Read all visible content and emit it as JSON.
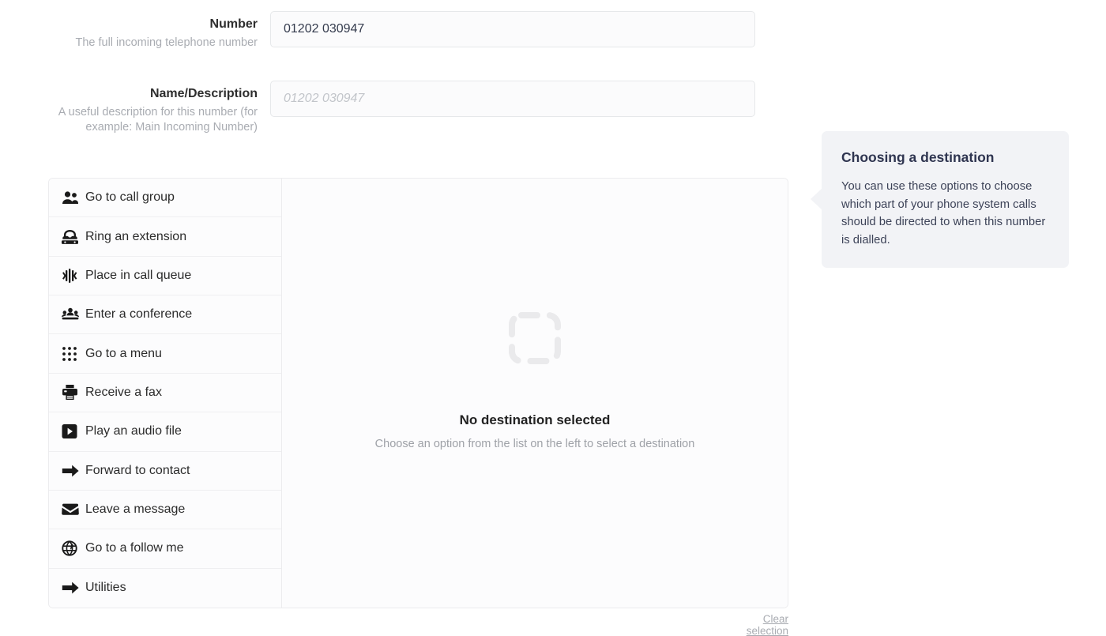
{
  "form": {
    "fields": [
      {
        "title": "Number",
        "help": "The full incoming telephone number",
        "value": "01202 030947",
        "placeholder": ""
      },
      {
        "title": "Name/Description",
        "help": "A useful description for this number (for example: Main Incoming Number)",
        "value": "",
        "placeholder": "01202 030947"
      }
    ]
  },
  "destination": {
    "options": [
      {
        "label": "Go to call group",
        "icon": "users-group-icon"
      },
      {
        "label": "Ring an extension",
        "icon": "telephone-icon"
      },
      {
        "label": "Place in call queue",
        "icon": "signal-bars-icon"
      },
      {
        "label": "Enter a conference",
        "icon": "conference-group-icon"
      },
      {
        "label": "Go to a menu",
        "icon": "keypad-grid-icon"
      },
      {
        "label": "Receive a fax",
        "icon": "fax-printer-icon"
      },
      {
        "label": "Play an audio file",
        "icon": "play-button-icon"
      },
      {
        "label": "Forward to contact",
        "icon": "arrow-right-icon"
      },
      {
        "label": "Leave a message",
        "icon": "envelope-icon"
      },
      {
        "label": "Go to a follow me",
        "icon": "globe-icon"
      },
      {
        "label": "Utilities",
        "icon": "arrow-right-icon"
      }
    ],
    "empty_state": {
      "icon": "dashed-square-icon",
      "title": "No destination selected",
      "subtitle": "Choose an option from the list on the left to select a destination"
    },
    "clear_label": "Clear selection"
  },
  "tooltip": {
    "title": "Choosing a destination",
    "body": "You can use these options to choose which part of your phone system calls should be directed to when this number is dialled."
  },
  "colors": {
    "panel_border": "#ececee",
    "list_bg": "#fcfcfd",
    "tooltip_bg": "#f2f3f6",
    "tooltip_title": "#2f3550",
    "input_text": "#343b4d",
    "muted_text": "#a9acb2"
  }
}
